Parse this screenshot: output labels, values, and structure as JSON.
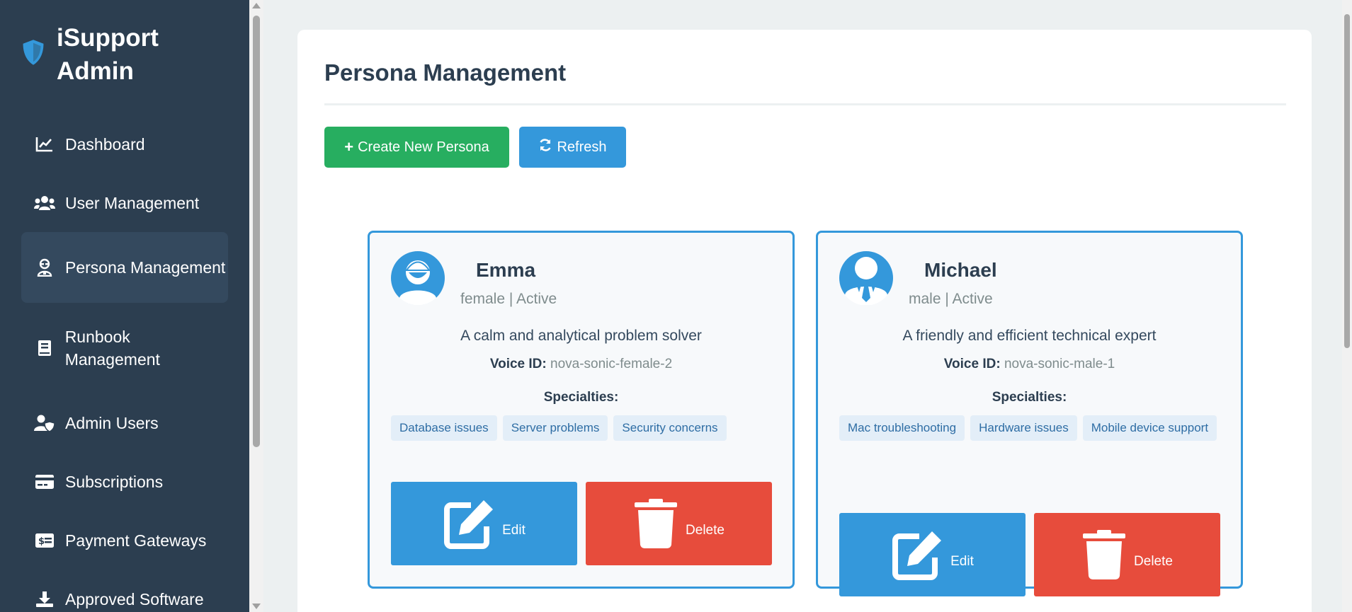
{
  "app": {
    "title": "iSupport Admin"
  },
  "sidebar": {
    "items": [
      {
        "label": "Dashboard",
        "icon": "chart-line-icon"
      },
      {
        "label": "User Management",
        "icon": "users-icon"
      },
      {
        "label": "Persona Management",
        "icon": "user-secret-icon",
        "active": true
      },
      {
        "label": "Runbook Management",
        "icon": "book-icon"
      },
      {
        "label": "Admin Users",
        "icon": "user-shield-icon"
      },
      {
        "label": "Subscriptions",
        "icon": "credit-card-icon"
      },
      {
        "label": "Payment Gateways",
        "icon": "money-check-icon"
      },
      {
        "label": "Approved Software",
        "icon": "download-icon"
      }
    ]
  },
  "main": {
    "title": "Persona Management",
    "create_label": "Create New Persona",
    "refresh_label": "Refresh",
    "specialties_label": "Specialties:",
    "voice_label": "Voice ID:",
    "edit_label": "Edit",
    "delete_label": "Delete"
  },
  "personas": [
    {
      "name": "Emma",
      "meta": "female | Active",
      "description": "A calm and analytical problem solver",
      "voice_id": "nova-sonic-female-2",
      "specialties": [
        "Database issues",
        "Server problems",
        "Security concerns"
      ]
    },
    {
      "name": "Michael",
      "meta": "male | Active",
      "description": "A friendly and efficient technical expert",
      "voice_id": "nova-sonic-male-1",
      "specialties": [
        "Mac troubleshooting",
        "Hardware issues",
        "Mobile device support"
      ]
    }
  ],
  "colors": {
    "sidebar_bg": "#2c3e50",
    "active_bg": "#34495e",
    "primary": "#3498db",
    "success": "#27ae60",
    "danger": "#e74c3c"
  }
}
